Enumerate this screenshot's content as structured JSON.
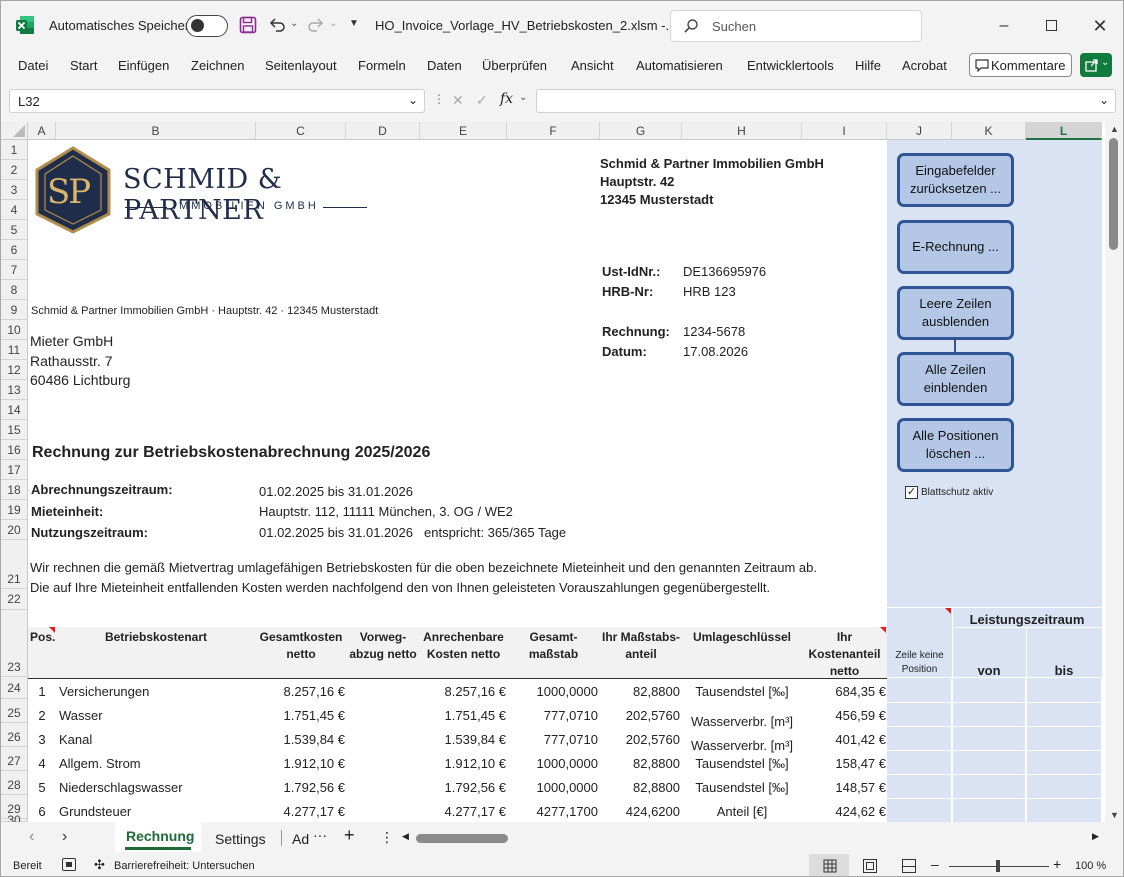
{
  "titlebar": {
    "autosave_label": "Automatisches Speichern",
    "filename": "HO_Invoice_Vorlage_HV_Betriebskosten_2.xlsm  -...",
    "search_placeholder": "Suchen"
  },
  "menu": [
    "Datei",
    "Start",
    "Einfügen",
    "Zeichnen",
    "Seitenlayout",
    "Formeln",
    "Daten",
    "Überprüfen",
    "Ansicht",
    "Automatisieren",
    "Entwicklertools",
    "Hilfe",
    "Acrobat"
  ],
  "kommentare_label": "Kommentare",
  "namebox": "L32",
  "fx_label": "fx",
  "columns": [
    "A",
    "B",
    "C",
    "D",
    "E",
    "F",
    "G",
    "H",
    "I",
    "J",
    "K",
    "L"
  ],
  "rows": [
    "1",
    "2",
    "3",
    "4",
    "5",
    "6",
    "7",
    "8",
    "9",
    "10",
    "11",
    "12",
    "13",
    "14",
    "15",
    "16",
    "17",
    "18",
    "19",
    "20",
    "21",
    "22",
    "23",
    "24",
    "25",
    "26",
    "27",
    "28",
    "29",
    "30"
  ],
  "logo": {
    "name": "SCHMID & PARTNER",
    "sub": "IMMOBILIEN GMBH",
    "mono": "SP"
  },
  "sender": {
    "company": "Schmid & Partner Immobilien GmbH",
    "street": "Hauptstr. 42",
    "city": "12345 Musterstadt"
  },
  "ids": {
    "ust_label": "Ust-IdNr.:",
    "ust_value": "DE136695976",
    "hrb_label": "HRB-Nr:",
    "hrb_value": "HRB 123",
    "rechnung_label": "Rechnung:",
    "rechnung_value": "1234-5678",
    "datum_label": "Datum:",
    "datum_value": "17.08.2026"
  },
  "sender_line": "Schmid & Partner Immobilien GmbH · Hauptstr. 42 · 12345 Musterstadt",
  "recipient": {
    "name": "Mieter GmbH",
    "street": "Rathausstr. 7",
    "city": "60486 Lichtburg"
  },
  "title": "Rechnung zur Betriebskostenabrechnung 2025/2026",
  "details": {
    "abrechnung_label": "Abrechnungszeitraum:",
    "abrechnung_value": "01.02.2025 bis 31.01.2026",
    "mieteinheit_label": "Mieteinheit:",
    "mieteinheit_value": "Hauptstr. 112, 11111 München, 3. OG / WE2",
    "nutzung_label": "Nutzungszeitraum:",
    "nutzung_value": "01.02.2025 bis 31.01.2026",
    "entspricht": "entspricht: 365/365 Tage"
  },
  "intro1": "Wir rechnen die gemäß Mietvertrag umlagefähigen Betriebskosten für die oben bezeichnete Mieteinheit und den genannten Zeitraum ab.",
  "intro2": "Die auf Ihre Mieteinheit entfallenden Kosten werden nachfolgend den von Ihnen geleisteten Vorauszahlungen gegenübergestellt.",
  "table_headers": {
    "pos": "Pos.",
    "art": "Betriebskostenart",
    "gesamt1": "Gesamtkosten",
    "gesamt2": "netto",
    "vorweg1": "Vorweg-",
    "vorweg2": "abzug netto",
    "anrech1": "Anrechenbare",
    "anrech2": "Kosten netto",
    "massstab1": "Gesamt-",
    "massstab2": "maßstab",
    "anteil1": "Ihr Maßstabs-",
    "anteil2": "anteil",
    "umlage": "Umlageschlüssel",
    "kosten1": "Ihr",
    "kosten2": "Kostenanteil",
    "kosten3": "netto",
    "keine1": "Zeile keine",
    "keine2": "Position",
    "leistung": "Leistungszeitraum",
    "von": "von",
    "bis": "bis"
  },
  "table_rows": [
    {
      "pos": "1",
      "art": "Versicherungen",
      "gesamt": "8.257,16 €",
      "vorweg": "",
      "anrech": "8.257,16 €",
      "massstab": "1000,0000",
      "anteil": "82,8800",
      "umlage": "Tausendstel [‰]",
      "kosten": "684,35 €"
    },
    {
      "pos": "2",
      "art": "Wasser",
      "gesamt": "1.751,45 €",
      "vorweg": "",
      "anrech": "1.751,45 €",
      "massstab": "777,0710",
      "anteil": "202,5760",
      "umlage": "Wasserverbr. [m³]",
      "kosten": "456,59 €"
    },
    {
      "pos": "3",
      "art": "Kanal",
      "gesamt": "1.539,84 €",
      "vorweg": "",
      "anrech": "1.539,84 €",
      "massstab": "777,0710",
      "anteil": "202,5760",
      "umlage": "Wasserverbr. [m³]",
      "kosten": "401,42 €"
    },
    {
      "pos": "4",
      "art": "Allgem. Strom",
      "gesamt": "1.912,10 €",
      "vorweg": "",
      "anrech": "1.912,10 €",
      "massstab": "1000,0000",
      "anteil": "82,8800",
      "umlage": "Tausendstel [‰]",
      "kosten": "158,47 €"
    },
    {
      "pos": "5",
      "art": "Niederschlagswasser",
      "gesamt": "1.792,56 €",
      "vorweg": "",
      "anrech": "1.792,56 €",
      "massstab": "1000,0000",
      "anteil": "82,8800",
      "umlage": "Tausendstel [‰]",
      "kosten": "148,57 €"
    },
    {
      "pos": "6",
      "art": "Grundsteuer",
      "gesamt": "4.277,17 €",
      "vorweg": "",
      "anrech": "4.277,17 €",
      "massstab": "4277,1700",
      "anteil": "424,6200",
      "umlage": "Anteil [€]",
      "kosten": "424,62 €"
    }
  ],
  "panel_buttons": {
    "reset": "Eingabefelder zurücksetzen ...",
    "erechnung": "E-Rechnung ...",
    "hide": "Leere Zeilen ausblenden",
    "show": "Alle Zeilen einblenden",
    "delete": "Alle Positionen löschen ..."
  },
  "blattschutz": "Blattschutz aktiv",
  "sheet_tabs": [
    "Rechnung",
    "Settings",
    "Ad"
  ],
  "status": {
    "ready": "Bereit",
    "access": "Barrierefreiheit: Untersuchen",
    "zoom": "100 %"
  },
  "colors": {
    "excel_green": "#117b3d",
    "panel": "#dae3f3",
    "button_fill": "#b4c7e7",
    "button_border": "#2f5597",
    "logo_navy": "#1f2d4a",
    "logo_gold": "#b08d4a"
  }
}
